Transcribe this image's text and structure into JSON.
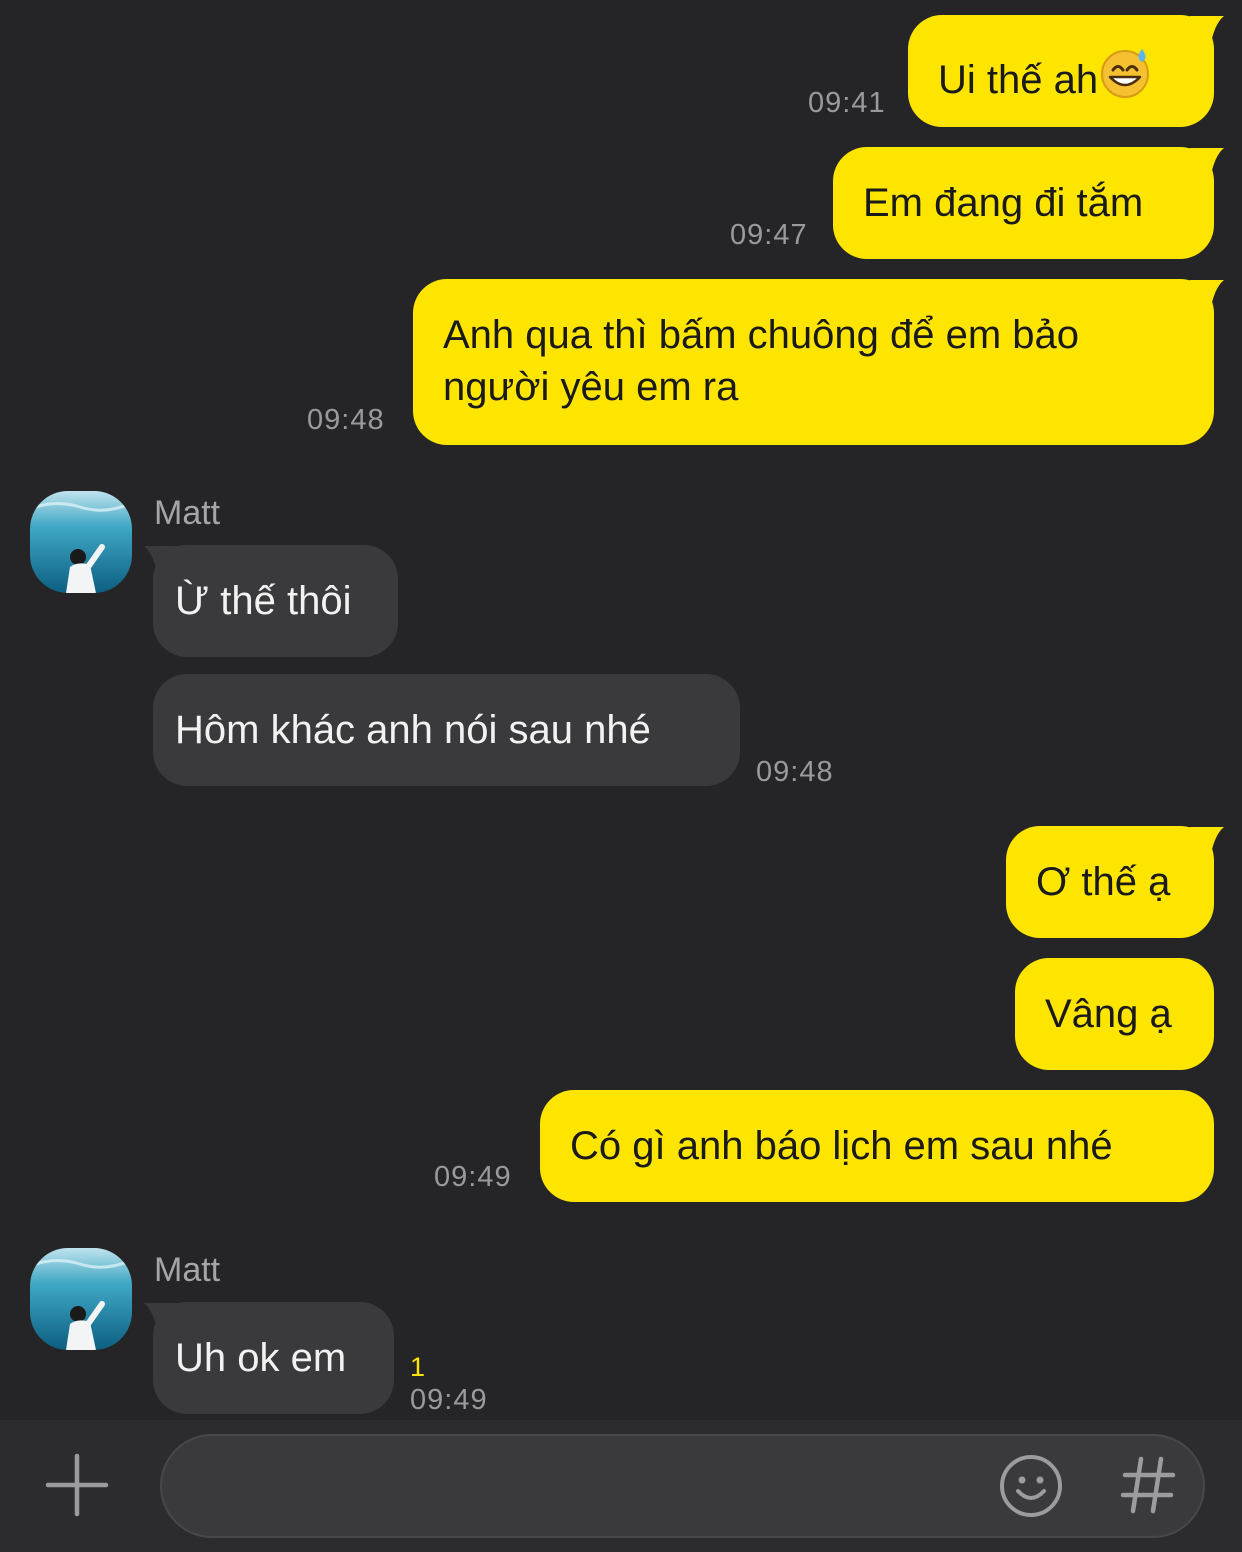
{
  "colors": {
    "background": "#252527",
    "my_bubble": "#FEE500",
    "their_bubble": "#3a3a3c",
    "timestamp": "#9a9a9e",
    "unread_indicator": "#FEE500"
  },
  "messages": [
    {
      "from": "me",
      "text": "Ui thế ah",
      "emoji": "sweat-smile-emoji",
      "time": "09:41"
    },
    {
      "from": "me",
      "text": "Em đang đi tắm",
      "time": "09:47"
    },
    {
      "from": "me",
      "text": "Anh qua thì bấm chuông để em bảo người yêu em ra",
      "time": "09:48"
    },
    {
      "from": "Matt",
      "sender_label": "Matt",
      "text": "Ừ thế thôi"
    },
    {
      "from": "Matt",
      "text": "Hôm khác anh nói sau nhé",
      "time": "09:48"
    },
    {
      "from": "me",
      "text": "Ơ thế ạ"
    },
    {
      "from": "me",
      "text": "Vâng ạ"
    },
    {
      "from": "me",
      "text": "Có gì anh báo lịch em sau nhé",
      "time": "09:49"
    },
    {
      "from": "Matt",
      "sender_label": "Matt",
      "text": "Uh ok em",
      "unread": "1",
      "time": "09:49"
    }
  ],
  "input_bar": {
    "value": "",
    "plus_icon": "plus-icon",
    "emoticon_icon": "smiley-icon",
    "hash_icon": "hash-icon"
  }
}
